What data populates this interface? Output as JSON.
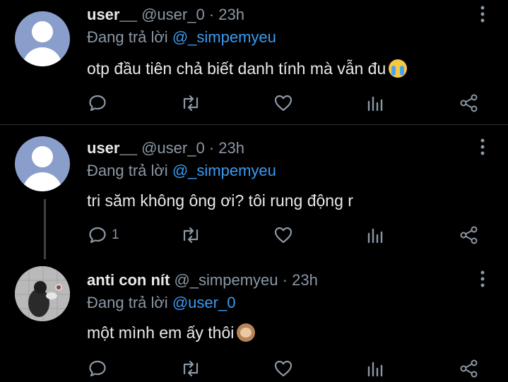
{
  "tweets": [
    {
      "display_name": "user__",
      "handle": "@user_0",
      "separator": "·",
      "time": "23h",
      "reply_prefix": "Đang trả lời",
      "reply_to": "@_simpemyeu",
      "text": "otp đầu tiên chả biết danh tính mà vẫn đu",
      "emoji": "loudly-crying-face",
      "reply_count": ""
    },
    {
      "display_name": "user__",
      "handle": "@user_0",
      "separator": "·",
      "time": "23h",
      "reply_prefix": "Đang trả lời",
      "reply_to": "@_simpemyeu",
      "text": "tri săm không ông ơi? tôi rung động r",
      "emoji": "",
      "reply_count": "1"
    },
    {
      "display_name": "anti con nít",
      "handle": "@_simpemyeu",
      "separator": "·",
      "time": "23h",
      "reply_prefix": "Đang trả lời",
      "reply_to": "@user_0",
      "text": "một mình em ấy thôi",
      "emoji": "see-no-evil-monkey",
      "reply_count": ""
    }
  ],
  "icons": {
    "reply": "comment-icon",
    "retweet": "retweet-icon",
    "like": "heart-icon",
    "analytics": "analytics-icon",
    "share": "share-icon",
    "more": "more-vertical-icon"
  },
  "colors": {
    "background": "#000000",
    "text": "#e7e9ea",
    "muted": "#8b98a5",
    "link": "#3a9bf0"
  }
}
